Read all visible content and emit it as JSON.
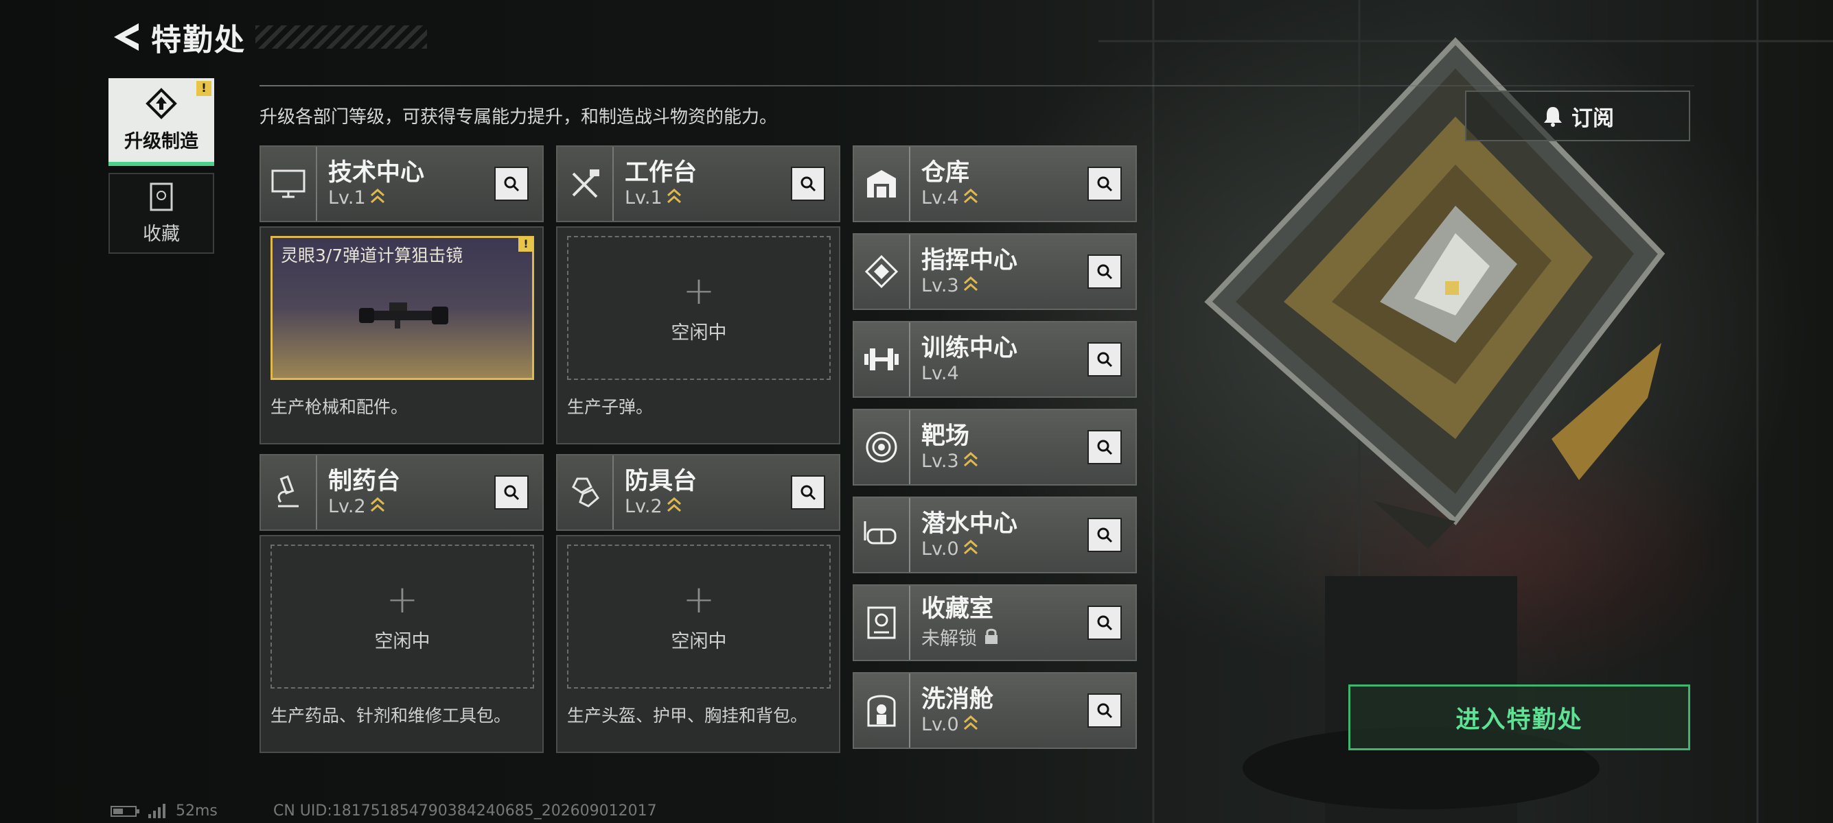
{
  "header": {
    "title": "特勤处"
  },
  "tabs": [
    {
      "label": "升级制造",
      "active": true,
      "badge": "!"
    },
    {
      "label": "收藏",
      "active": false
    }
  ],
  "description": "升级各部门等级，可获得专属能力提升，和制造战斗物资的能力。",
  "subscribe": {
    "label": "订阅"
  },
  "production": [
    {
      "name": "技术中心",
      "level": "Lv.1",
      "slot_status": "",
      "slot_item": "灵眼3/7弹道计算狙击镜",
      "slot_badge": "!",
      "desc": "生产枪械和配件。"
    },
    {
      "name": "工作台",
      "level": "Lv.1",
      "slot_status": "空闲中",
      "desc": "生产子弹。"
    },
    {
      "name": "制药台",
      "level": "Lv.2",
      "slot_status": "空闲中",
      "desc": "生产药品、针剂和维修工具包。"
    },
    {
      "name": "防具台",
      "level": "Lv.2",
      "slot_status": "空闲中",
      "desc": "生产头盔、护甲、胸挂和背包。"
    }
  ],
  "departments": [
    {
      "name": "仓库",
      "level": "Lv.4",
      "icon": "warehouse-icon"
    },
    {
      "name": "指挥中心",
      "level": "Lv.3",
      "icon": "command-icon"
    },
    {
      "name": "训练中心",
      "level": "Lv.4",
      "icon": "dumbbell-icon"
    },
    {
      "name": "靶场",
      "level": "Lv.3",
      "icon": "target-icon"
    },
    {
      "name": "潜水中心",
      "level": "Lv.0",
      "icon": "diving-goggles-icon"
    },
    {
      "name": "收藏室",
      "level": "未解锁",
      "icon": "collection-icon",
      "locked": true
    },
    {
      "name": "洗消舱",
      "level": "Lv.0",
      "icon": "decon-pod-icon"
    }
  ],
  "enter_button": {
    "label": "进入特勤处"
  },
  "status_bar": {
    "ping": "52ms",
    "uid": "CN UID:181751854790384240685_202609012017"
  },
  "colors": {
    "accent_green": "#4ed08a",
    "gold": "#e0b94e"
  }
}
